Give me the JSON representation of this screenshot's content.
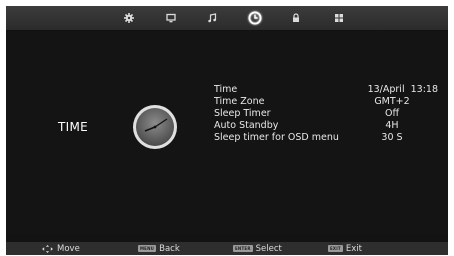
{
  "tabs": [
    {
      "icon": "picture-gear-icon"
    },
    {
      "icon": "monitor-icon"
    },
    {
      "icon": "music-note-icon"
    },
    {
      "icon": "clock-icon",
      "active": true
    },
    {
      "icon": "lock-icon"
    },
    {
      "icon": "grid-icon"
    }
  ],
  "section": {
    "title": "TIME",
    "icon": "clock-icon"
  },
  "menu": {
    "items": [
      {
        "label": "Time",
        "value": "13/April  13:18"
      },
      {
        "label": "Time Zone",
        "value": "GMT+2"
      },
      {
        "label": "Sleep Timer",
        "value": "Off"
      },
      {
        "label": "Auto Standby",
        "value": "4H"
      },
      {
        "label": "Sleep timer for OSD menu",
        "value": "30 S"
      }
    ]
  },
  "footer": {
    "move": {
      "icon": "move-arrows-icon",
      "label": "Move"
    },
    "back": {
      "key": "MENU",
      "label": "Back"
    },
    "select": {
      "key": "ENTER",
      "label": "Select"
    },
    "exit": {
      "key": "EXIT",
      "label": "Exit"
    }
  },
  "colors": {
    "background": "#141414",
    "topbar": "#333333",
    "footer": "#2e2e2e",
    "text": "#e8e8e8"
  }
}
